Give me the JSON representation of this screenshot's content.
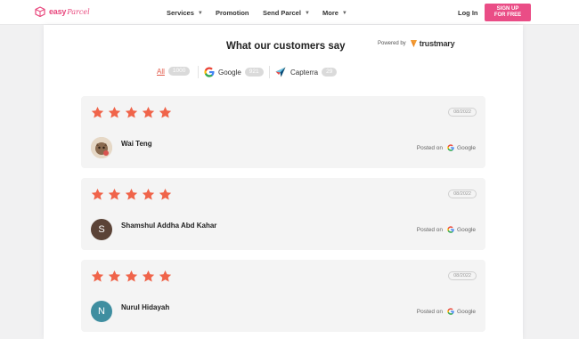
{
  "nav": {
    "logo_text": "easy",
    "logo_script": "Parcel",
    "items": [
      {
        "label": "Services",
        "dropdown": true
      },
      {
        "label": "Promotion",
        "dropdown": false
      },
      {
        "label": "Send Parcel",
        "dropdown": true
      },
      {
        "label": "More",
        "dropdown": true
      }
    ],
    "login_label": "Log In",
    "signup_line1": "SIGN UP",
    "signup_line2": "FOR FREE"
  },
  "reviews_section": {
    "heading": "What our customers say",
    "powered_by_label": "Powered by",
    "powered_by_brand": "trustmary",
    "filters": [
      {
        "label": "All",
        "count": "1000",
        "icon": "none",
        "active": true
      },
      {
        "label": "Google",
        "count": "921",
        "icon": "google-icon",
        "active": false
      },
      {
        "label": "Capterra",
        "count": "29",
        "icon": "capterra-icon",
        "active": false
      }
    ],
    "reviews": [
      {
        "rating": 5,
        "date": "08/2022",
        "name": "Wai Teng",
        "avatar_initial": "",
        "avatar_type": "photo",
        "posted_on_label": "Posted on",
        "source": "Google"
      },
      {
        "rating": 5,
        "date": "08/2022",
        "name": "Shamshul Addha Abd Kahar",
        "avatar_initial": "S",
        "avatar_type": "initial",
        "avatar_color": "#5b4337",
        "posted_on_label": "Posted on",
        "source": "Google"
      },
      {
        "rating": 5,
        "date": "08/2022",
        "name": "Nurul Hidayah",
        "avatar_initial": "N",
        "avatar_type": "initial",
        "avatar_color": "#3f8ea0",
        "posted_on_label": "Posted on",
        "source": "Google"
      }
    ]
  },
  "colors": {
    "brand_pink": "#ea4d86",
    "star": "#f0644a",
    "active_filter": "#e25a4a"
  }
}
